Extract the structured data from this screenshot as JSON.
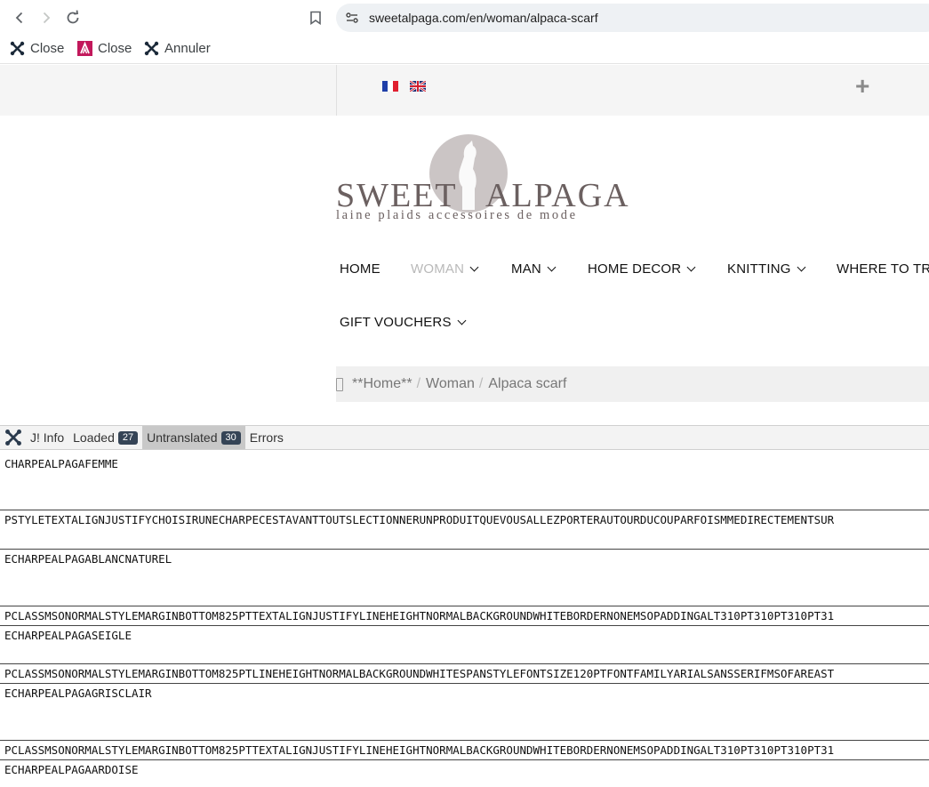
{
  "browser": {
    "url": "sweetalpaga.com/en/woman/alpaca-scarf"
  },
  "bookmarks": [
    {
      "label": "Close",
      "icon": "joomla-icon"
    },
    {
      "label": "Close",
      "icon": "magenta-logo-icon"
    },
    {
      "label": "Annuler",
      "icon": "joomla-icon"
    }
  ],
  "site": {
    "logo": {
      "word1": "SWEET",
      "word2": "ALPAGA",
      "tagline": "laine plaids accessoires de mode"
    },
    "menu": [
      {
        "label": "HOME",
        "active": false,
        "dropdown": false
      },
      {
        "label": "WOMAN",
        "active": true,
        "dropdown": true
      },
      {
        "label": "MAN",
        "active": false,
        "dropdown": true
      },
      {
        "label": "HOME DECOR",
        "active": false,
        "dropdown": true
      },
      {
        "label": "KNITTING",
        "active": false,
        "dropdown": true
      },
      {
        "label": "WHERE TO TR",
        "active": false,
        "dropdown": false
      },
      {
        "label": "GIFT VOUCHERS",
        "active": false,
        "dropdown": true
      }
    ],
    "breadcrumb": {
      "icon": "",
      "items": [
        "**Home**",
        "Woman",
        "Alpaca scarf"
      ]
    }
  },
  "debug": {
    "info": "J! Info",
    "loaded": {
      "label": "Loaded",
      "count": "27"
    },
    "untranslated": {
      "label": "Untranslated",
      "count": "30"
    },
    "errors": "Errors"
  },
  "strings": [
    "CHARPEALPAGAFEMME",
    "PSTYLETEXTALIGNJUSTIFYCHOISIRUNECHARPECESTAVANTTOUTSLECTIONNERUNPRODUITQUEVOUSALLEZPORTERAUTOURDUCOUPARFOISMMEDIRECTEMENTSUR",
    "ECHARPEALPAGABLANCNATUREL",
    "PCLASSMSONORMALSTYLEMARGINBOTTOM825PTTEXTALIGNJUSTIFYLINEHEIGHTNORMALBACKGROUNDWHITEBORDERNONEMSOPADDINGALT310PT310PT310PT31",
    "ECHARPEALPAGASEIGLE",
    "PCLASSMSONORMALSTYLEMARGINBOTTOM825PTLINEHEIGHTNORMALBACKGROUNDWHITESPANSTYLEFONTSIZE120PTFONTFAMILYARIALSANSSERIFMSOFAREAST",
    "ECHARPEALPAGAGRISCLAIR",
    "PCLASSMSONORMALSTYLEMARGINBOTTOM825PTTEXTALIGNJUSTIFYLINEHEIGHTNORMALBACKGROUNDWHITEBORDERNONEMSOPADDINGALT310PT310PT310PT31",
    "ECHARPEALPAGAARDOISE"
  ]
}
